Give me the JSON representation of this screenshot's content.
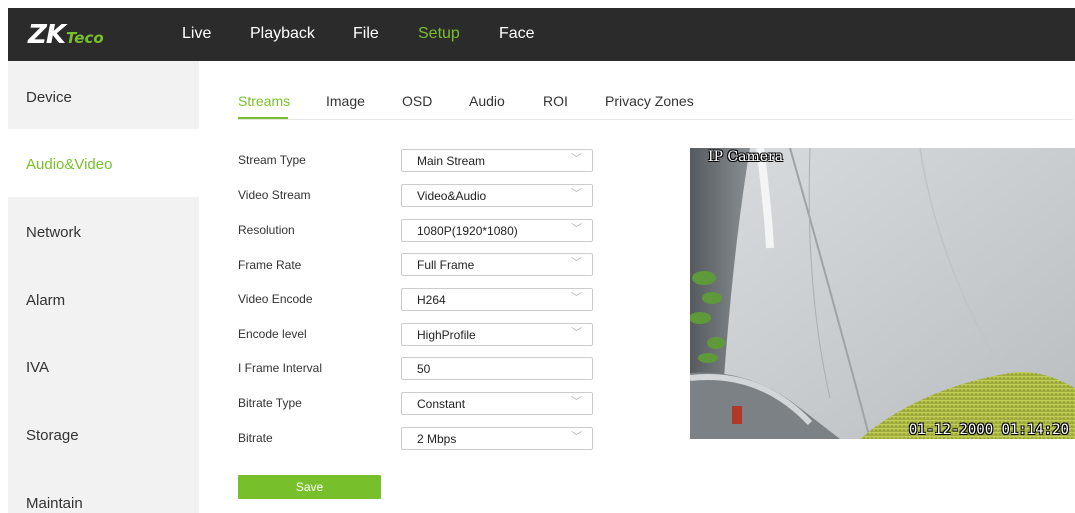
{
  "brand": {
    "logo_main": "ZK",
    "logo_sub": "Teco",
    "accent_color": "#78c02b",
    "topbar_color": "#2b2b2b"
  },
  "topnav": {
    "items": [
      "Live",
      "Playback",
      "File",
      "Setup",
      "Face"
    ],
    "active": "Setup"
  },
  "sidebar": {
    "items": [
      "Device",
      "Audio&Video",
      "Network",
      "Alarm",
      "IVA",
      "Storage",
      "Maintain"
    ],
    "active": "Audio&Video"
  },
  "tabs": {
    "items": [
      "Streams",
      "Image",
      "OSD",
      "Audio",
      "ROI",
      "Privacy Zones"
    ],
    "active": "Streams"
  },
  "form": {
    "fields": [
      {
        "label": "Stream Type",
        "value": "Main Stream",
        "kind": "select"
      },
      {
        "label": "Video Stream",
        "value": "Video&Audio",
        "kind": "select"
      },
      {
        "label": "Resolution",
        "value": "1080P(1920*1080)",
        "kind": "select"
      },
      {
        "label": "Frame Rate",
        "value": "Full Frame",
        "kind": "select"
      },
      {
        "label": "Video Encode",
        "value": "H264",
        "kind": "select"
      },
      {
        "label": "Encode level",
        "value": "HighProfile",
        "kind": "select"
      },
      {
        "label": "I Frame Interval",
        "value": "50",
        "kind": "text"
      },
      {
        "label": "Bitrate Type",
        "value": "Constant",
        "kind": "select"
      },
      {
        "label": "Bitrate",
        "value": "2 Mbps",
        "kind": "select"
      }
    ],
    "chevron": "﹀",
    "save_label": "Save"
  },
  "preview": {
    "osd_title": "IP Camera",
    "osd_timestamp": "01-12-2000 01:14:20"
  }
}
